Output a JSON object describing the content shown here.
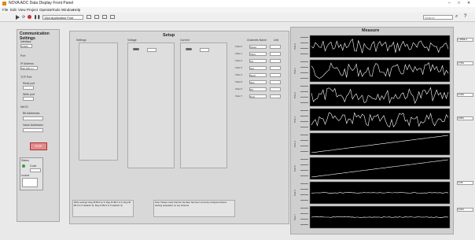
{
  "window": {
    "title": "NOVA ADC Data Display Front Panel",
    "win_controls": [
      "–",
      "□",
      "✕"
    ]
  },
  "menu": [
    "File",
    "Edit",
    "View",
    "Project",
    "Operate",
    "Tools",
    "Window",
    "Help"
  ],
  "toolbar": {
    "font_label": "15pt Application Font",
    "search_label": "Search"
  },
  "comm": {
    "title": "Communication Settings",
    "labels": [
      "Interface",
      "Port",
      "IP Address",
      "TCP Port",
      "Read port",
      "Write port",
      "Net ID",
      "Bit Addresses",
      "Value Addresses"
    ],
    "values": [
      "COM4",
      "",
      "192.168.1.1",
      "",
      "",
      "",
      "",
      "",
      ""
    ],
    "stop_label": "STOP",
    "status_labels": [
      "Status",
      "Code",
      "source"
    ]
  },
  "setup": {
    "title": "Setup",
    "col_headers": [
      "Settings",
      "Voltage",
      "Current",
      "Channels Name",
      "Unit"
    ],
    "channel_names": [
      "Vload",
      "Vbus",
      "Vin",
      "Iout",
      "Iload",
      "Ibus",
      "Pin",
      "Pout"
    ],
    "channel_prefix": [
      "Chan 0",
      "Chan 1",
      "Chan 2",
      "Chan 3",
      "Chan 4",
      "Chan 5",
      "Chan 6",
      "Chan 7"
    ],
    "note_left": "Write settings: Reg 30 Bit 0 to 5, Reg 31 Bit 0 to 5, Reg 40 Bit 0 to 5 (default: 0), Reg 41 Bit 0 to 5 (default: 0)",
    "note_right": "Note: Please verify that the interface has been correctly configured before starting acquisition on any channel."
  },
  "measure": {
    "title": "Measure",
    "plot_labels": [
      "Plot 0",
      "Plot 1",
      "Plot 2",
      "Plot 3",
      "Plot 4",
      "Plot 5",
      "Plot 6",
      "Plot 7"
    ],
    "right_values": [
      "1.4589E-3",
      "0.7584",
      "0.0182",
      "0.6852",
      "",
      "",
      "0.048",
      "0.0291"
    ]
  },
  "colors": {
    "trace": "#ffffff",
    "plot_bg": "#000000",
    "accent_red": "#e48b8b",
    "app_bg": "#e9e9e9"
  },
  "icons": [
    "labview-icon",
    "run-icon",
    "run-continuously-icon",
    "abort-icon",
    "pause-icon",
    "search-icon",
    "help-icon"
  ]
}
